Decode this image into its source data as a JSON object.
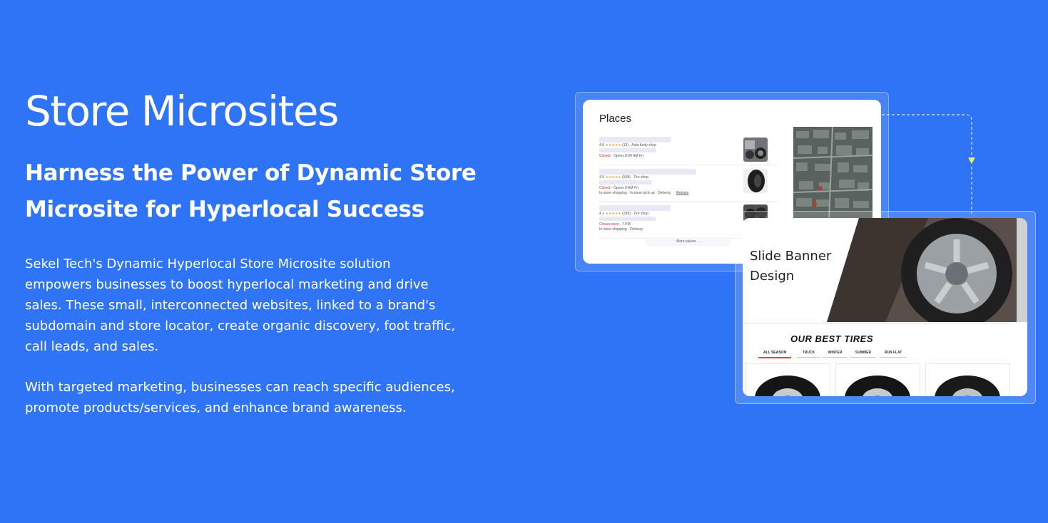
{
  "hero": {
    "title": "Store Microsites",
    "subtitle": "Harness the Power of Dynamic Store Microsite for Hyperlocal Success",
    "paragraph1": "Sekel Tech's Dynamic Hyperlocal Store Microsite solution empowers businesses to boost hyperlocal marketing and drive sales. These small, interconnected websites, linked to a brand's subdomain and store locator, create organic discovery, foot traffic, call leads, and sales.",
    "paragraph2": "With targeted marketing, businesses can reach specific audiences, promote products/services, and enhance brand awareness."
  },
  "places_card": {
    "title": "Places",
    "results": [
      {
        "rating": "4.8",
        "stars": "★★★★★",
        "reviews": "(13)",
        "category": "Auto body shop",
        "status": "Closed",
        "status_detail": "· Opens 8:00 AM Fri",
        "extra": ""
      },
      {
        "rating": "4.5",
        "stars": "★★★★★",
        "reviews": "(508)",
        "category": "Tire shop",
        "status": "Closed",
        "status_detail": "· Opens 8 AM Fri",
        "extra": "In-store shopping · In-store pick-up · Delivery"
      },
      {
        "rating": "4.1",
        "stars": "★★★★★",
        "reviews": "(336)",
        "category": "Tire shop",
        "status": "Closes soon",
        "status_detail": "· 7 PM",
        "extra": "In-store shopping · Delivery"
      }
    ],
    "website_link": "Website",
    "more_places": "More places →"
  },
  "banner_card": {
    "title": "Slide Banner Design",
    "section_heading": "OUR BEST TIRES",
    "tabs": [
      "ALL SEASON",
      "TRUCK",
      "WINTER",
      "SUMMER",
      "RUN FLAT"
    ],
    "active_tab": "ALL SEASON"
  },
  "colors": {
    "background": "#2e74f5",
    "text": "#ffffff",
    "closed": "#d93025",
    "active_tab": "#d94b3c"
  }
}
